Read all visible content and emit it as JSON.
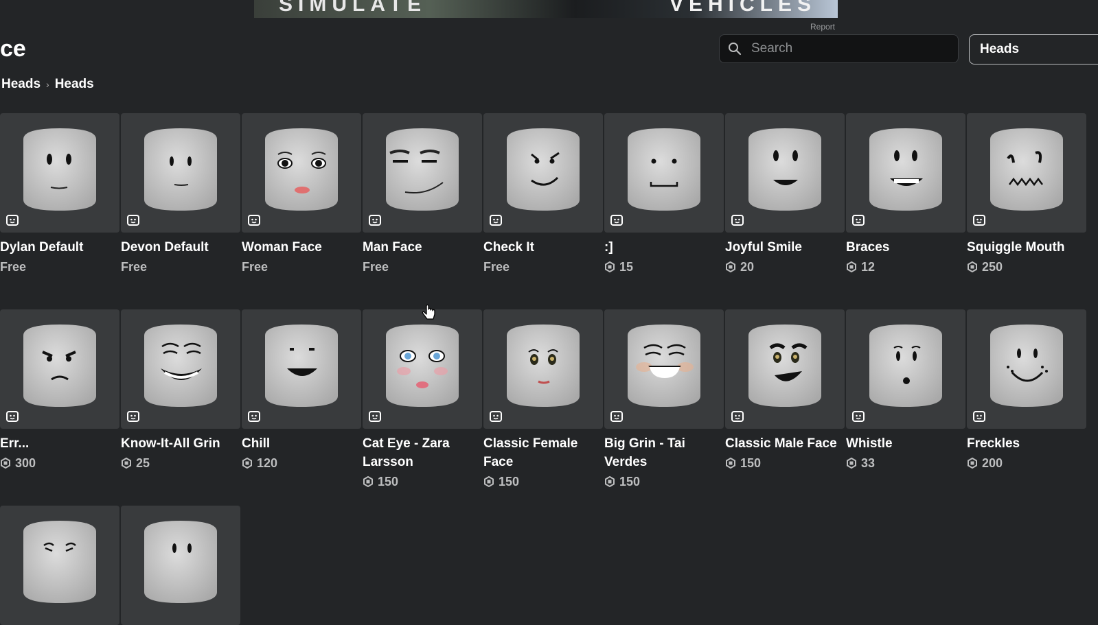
{
  "banner": {
    "left_text": "SIMULATE",
    "right_text": "VEHICLES",
    "report": "Report"
  },
  "page": {
    "title": "ce"
  },
  "search": {
    "placeholder": "Search"
  },
  "filter": {
    "selected": "Heads"
  },
  "breadcrumb": {
    "items": [
      "Heads",
      "Heads"
    ]
  },
  "items": [
    {
      "name": "Dylan Default",
      "price": "Free",
      "robux": false
    },
    {
      "name": "Devon Default",
      "price": "Free",
      "robux": false
    },
    {
      "name": "Woman Face",
      "price": "Free",
      "robux": false
    },
    {
      "name": "Man Face",
      "price": "Free",
      "robux": false
    },
    {
      "name": "Check It",
      "price": "Free",
      "robux": false
    },
    {
      "name": ":]",
      "price": "15",
      "robux": true
    },
    {
      "name": "Joyful Smile",
      "price": "20",
      "robux": true
    },
    {
      "name": "Braces",
      "price": "12",
      "robux": true
    },
    {
      "name": "Squiggle Mouth",
      "price": "250",
      "robux": true
    },
    {
      "name": "Err...",
      "price": "300",
      "robux": true
    },
    {
      "name": "Know-It-All Grin",
      "price": "25",
      "robux": true
    },
    {
      "name": "Chill",
      "price": "120",
      "robux": true
    },
    {
      "name": "Cat Eye - Zara Larsson",
      "price": "150",
      "robux": true
    },
    {
      "name": "Classic Female Face",
      "price": "150",
      "robux": true
    },
    {
      "name": "Big Grin - Tai Verdes",
      "price": "150",
      "robux": true
    },
    {
      "name": "Classic Male Face",
      "price": "150",
      "robux": true
    },
    {
      "name": "Whistle",
      "price": "33",
      "robux": true
    },
    {
      "name": "Freckles",
      "price": "200",
      "robux": true
    },
    {
      "name": "",
      "price": "",
      "robux": false
    },
    {
      "name": "",
      "price": "",
      "robux": false
    }
  ],
  "colors": {
    "background": "#232527",
    "card": "#393b3d",
    "head": "#c9c9c9",
    "price_text": "#bdbebf"
  }
}
